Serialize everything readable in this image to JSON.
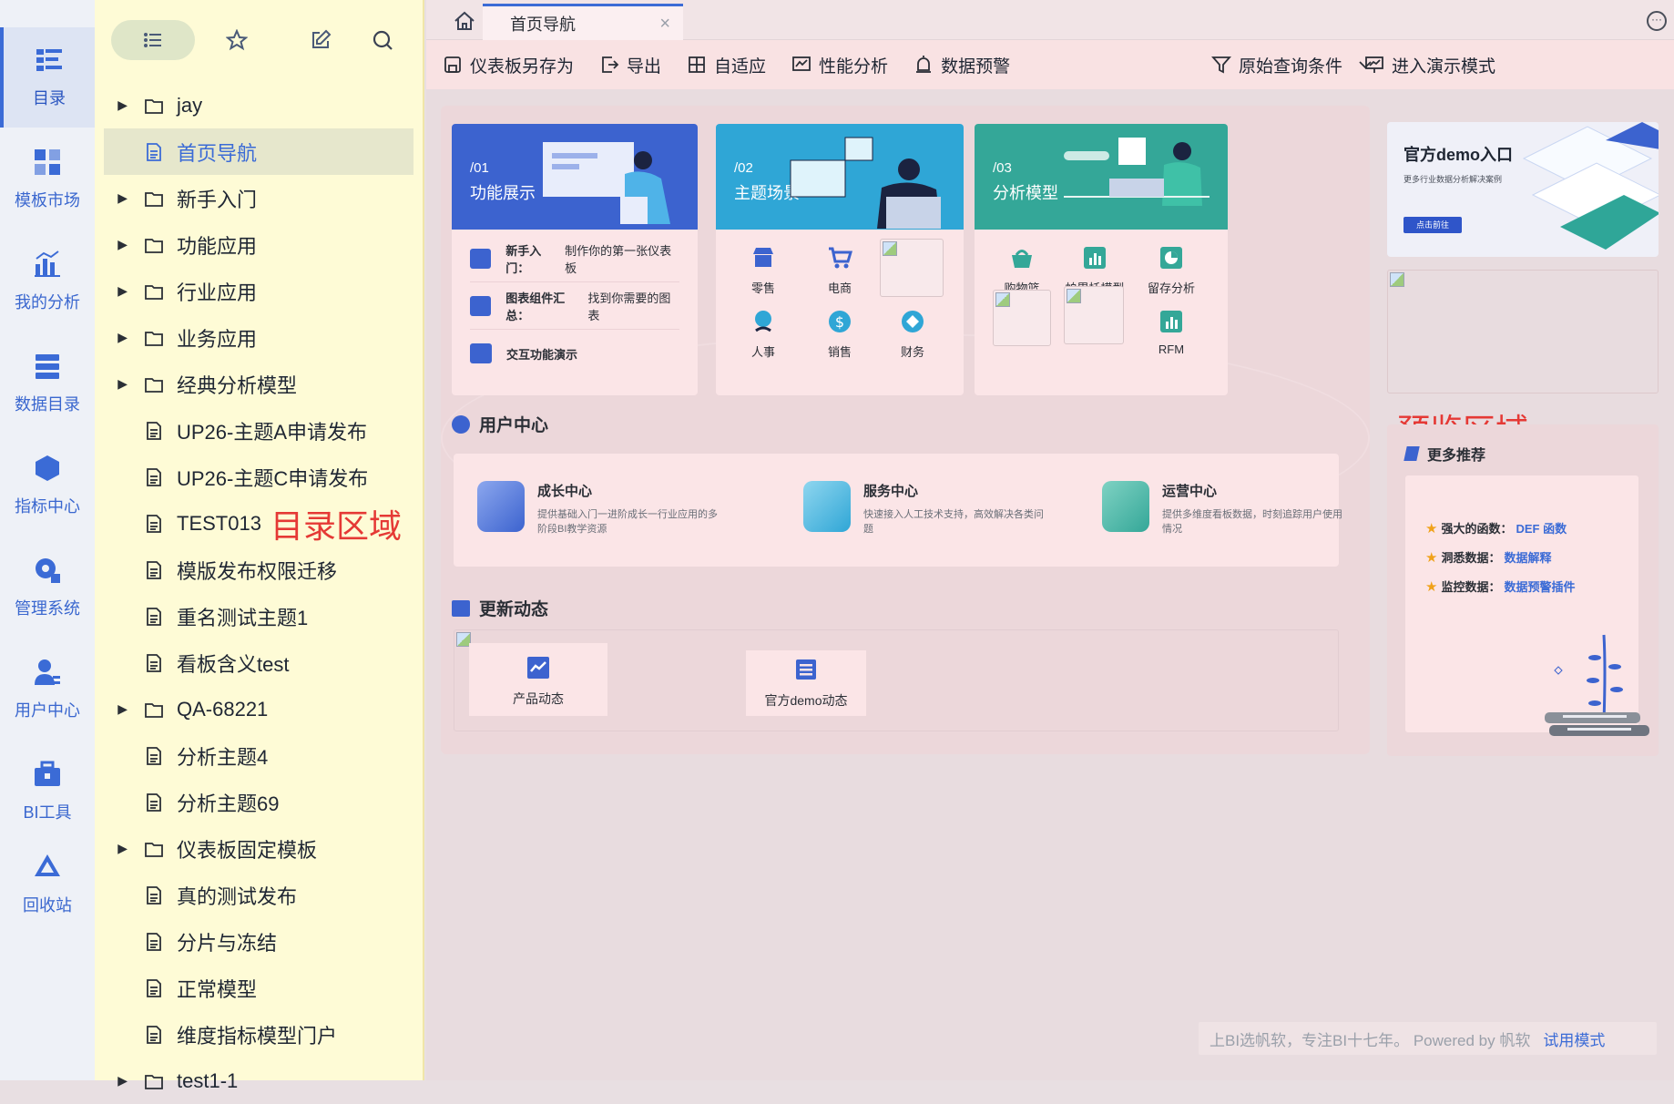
{
  "rail": {
    "items": [
      {
        "label": "目录",
        "icon": "catalog-icon",
        "active": true
      },
      {
        "label": "模板市场",
        "icon": "template-market-icon"
      },
      {
        "label": "我的分析",
        "icon": "my-analysis-icon"
      },
      {
        "label": "数据目录",
        "icon": "data-catalog-icon"
      },
      {
        "label": "指标中心",
        "icon": "metrics-center-icon"
      },
      {
        "label": "管理系统",
        "icon": "admin-system-icon"
      },
      {
        "label": "用户中心",
        "icon": "user-center-icon"
      },
      {
        "label": "BI工具",
        "icon": "bi-tools-icon"
      },
      {
        "label": "回收站",
        "icon": "recycle-bin-icon"
      }
    ]
  },
  "tree": {
    "annotation": "目录区域",
    "rows": [
      {
        "label": "jay",
        "type": "folder"
      },
      {
        "label": "首页导航",
        "type": "file",
        "selected": true
      },
      {
        "label": "新手入门",
        "type": "folder"
      },
      {
        "label": "功能应用",
        "type": "folder"
      },
      {
        "label": "行业应用",
        "type": "folder"
      },
      {
        "label": "业务应用",
        "type": "folder"
      },
      {
        "label": "经典分析模型",
        "type": "folder"
      },
      {
        "label": "UP26-主题A申请发布",
        "type": "file"
      },
      {
        "label": "UP26-主题C申请发布",
        "type": "file"
      },
      {
        "label": "TEST013",
        "type": "file"
      },
      {
        "label": "模版发布权限迁移",
        "type": "file"
      },
      {
        "label": "重名测试主题1",
        "type": "file"
      },
      {
        "label": "看板含义test",
        "type": "file"
      },
      {
        "label": "QA-68221",
        "type": "folder"
      },
      {
        "label": "分析主题4",
        "type": "file"
      },
      {
        "label": "分析主题69",
        "type": "file"
      },
      {
        "label": "仪表板固定模板",
        "type": "folder"
      },
      {
        "label": "真的测试发布",
        "type": "file"
      },
      {
        "label": "分片与冻结",
        "type": "file"
      },
      {
        "label": "正常模型",
        "type": "file"
      },
      {
        "label": "维度指标模型门户",
        "type": "file"
      },
      {
        "label": "test1-1",
        "type": "folder"
      }
    ]
  },
  "tabbar": {
    "tab_label": "首页导航",
    "close": "×"
  },
  "toolbar": {
    "save_as": "仪表板另存为",
    "export": "导出",
    "adaptive": "自适应",
    "performance": "性能分析",
    "alert": "数据预警",
    "query": "原始查询条件",
    "present": "进入演示模式"
  },
  "cards": {
    "c1": {
      "num": "/01",
      "title": "功能展示",
      "items": [
        {
          "bold": "新手入门：",
          "text": "制作你的第一张仪表板"
        },
        {
          "bold": "图表组件汇总：",
          "text": "找到你需要的图表"
        },
        {
          "bold": "交互功能演示",
          "text": ""
        }
      ]
    },
    "c2": {
      "num": "/02",
      "title": "主题场景",
      "items": [
        "零售",
        "电商",
        "人事",
        "销售",
        "财务"
      ]
    },
    "c3": {
      "num": "/03",
      "title": "分析模型",
      "items": [
        "购物篮",
        "帕累托模型",
        "留存分析",
        "RFM"
      ]
    }
  },
  "user_center": {
    "title": "用户中心",
    "items": [
      {
        "title": "成长中心",
        "desc": "提供基础入门一进阶成长一行业应用的多阶段BI教学资源"
      },
      {
        "title": "服务中心",
        "desc": "快速接入人工技术支持，高效解决各类问题"
      },
      {
        "title": "运营中心",
        "desc": "提供多维度看板数据，时刻追踪用户使用情况"
      }
    ]
  },
  "updates": {
    "title": "更新动态",
    "items": [
      "产品动态",
      "官方demo动态"
    ]
  },
  "preview_annotation": "预览区域",
  "demo": {
    "title": "官方demo入口",
    "subtitle": "更多行业数据分析解决案例",
    "button": "点击前往"
  },
  "recommend": {
    "title": "更多推荐",
    "items": [
      {
        "label": "强大的函数：",
        "link": "DEF 函数"
      },
      {
        "label": "洞悉数据：",
        "link": "数据解释"
      },
      {
        "label": "监控数据：",
        "link": "数据预警插件"
      }
    ]
  },
  "footer": {
    "text": "上BI选帆软，专注BI十七年。 Powered by 帆软",
    "trial": "试用模式"
  },
  "colors": {
    "accent": "#3b6bd6",
    "tree_bg": "#fefbd6",
    "annotation": "#e53935"
  }
}
